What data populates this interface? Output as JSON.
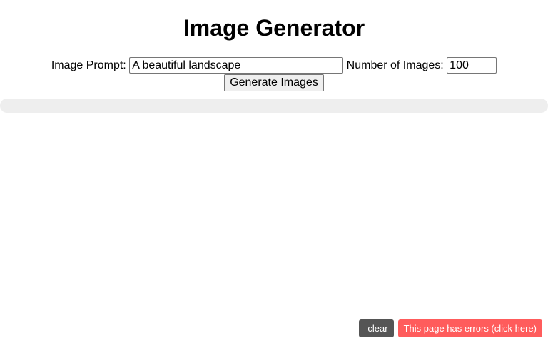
{
  "page": {
    "title": "Image Generator"
  },
  "form": {
    "prompt_label": "Image Prompt:",
    "prompt_value": "A beautiful landscape",
    "count_label": "Number of Images:",
    "count_value": "100",
    "generate_label": "Generate Images"
  },
  "progress": {
    "fraction": 0
  },
  "console_bar": {
    "clear_icon": "",
    "clear_label": "clear",
    "error_label": "This page has errors (click here)"
  },
  "colors": {
    "progress_track": "#eeeeee",
    "clear_bg": "#555555",
    "error_bg": "#ff5c5c"
  }
}
